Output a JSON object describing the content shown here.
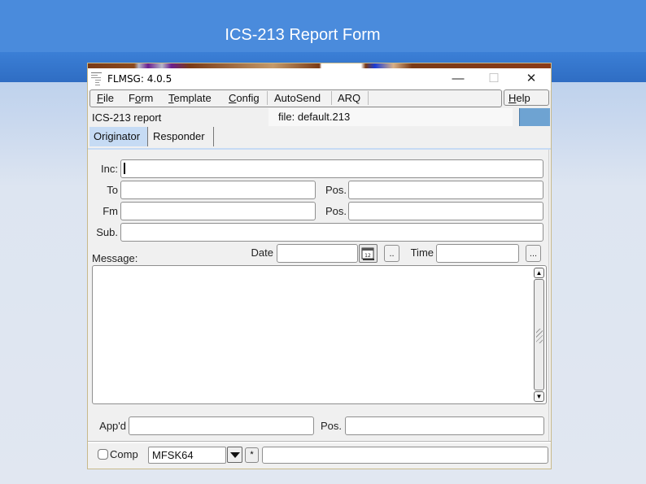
{
  "slide": {
    "title": "ICS-213 Report Form"
  },
  "window": {
    "title": "FLMSG: 4.0.5",
    "controls": {
      "minimize": "—",
      "maximize": "☐",
      "close": "✕"
    }
  },
  "menubar": {
    "items": [
      {
        "label": "File",
        "accel_index": 0
      },
      {
        "label": "Form",
        "accel_index": 1
      },
      {
        "label": "Template",
        "accel_index": 0
      },
      {
        "label": "Config",
        "accel_index": 0
      },
      {
        "label": "AutoSend"
      },
      {
        "label": "ARQ"
      }
    ],
    "help": "Help"
  },
  "infobar": {
    "form_name": "ICS-213 report",
    "file_name": "file: default.213",
    "status_color": "#6ea3d2"
  },
  "tabs": [
    {
      "label": "Originator",
      "active": true
    },
    {
      "label": "Responder",
      "active": false
    }
  ],
  "originator": {
    "inc_label": "Inc:",
    "inc_value": "",
    "to_label": "To",
    "to_value": "",
    "to_pos_label": "Pos.",
    "to_pos_value": "",
    "fm_label": "Fm",
    "fm_value": "",
    "fm_pos_label": "Pos.",
    "fm_pos_value": "",
    "sub_label": "Sub.",
    "sub_value": "",
    "date_label": "Date",
    "date_value": "",
    "calendar_icon_text": "12",
    "date_now_button": "..",
    "time_label": "Time",
    "time_value": "",
    "time_now_button": "...",
    "message_label": "Message:",
    "message_value": "",
    "appd_label": "App'd",
    "appd_value": "",
    "appd_pos_label": "Pos.",
    "appd_pos_value": ""
  },
  "bottombar": {
    "comp_label": "Comp",
    "comp_checked": false,
    "mode_value": "MFSK64",
    "star_button": "*",
    "status_value": ""
  }
}
